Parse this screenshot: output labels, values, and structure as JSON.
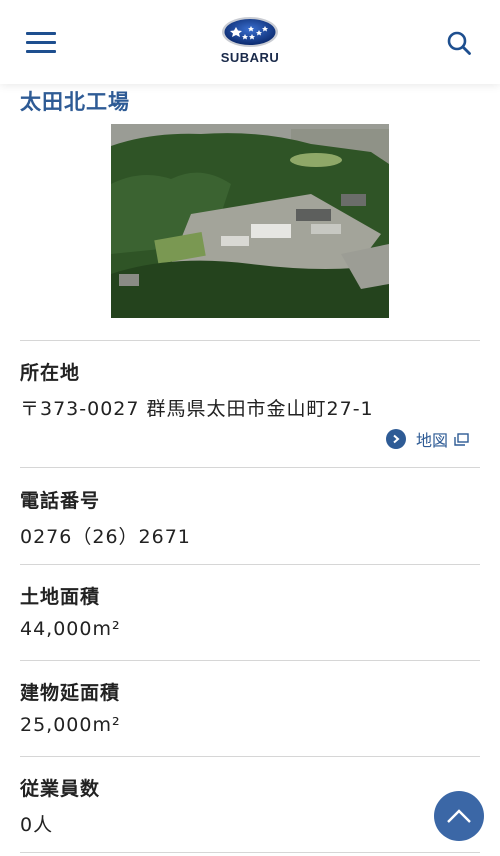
{
  "header": {
    "menu_icon": "hamburger-menu-icon",
    "logo_text": "SUBARU",
    "search_icon": "search-icon"
  },
  "page": {
    "title": "太田北工場"
  },
  "info": {
    "address_label": "所在地",
    "address_value": "〒373-0027 群馬県太田市金山町27-1",
    "map_link_label": "地図",
    "phone_label": "電話番号",
    "phone_value": "0276（26）2671",
    "land_area_label": "土地面積",
    "land_area_value": "44,000m²",
    "floor_area_label": "建物延面積",
    "floor_area_value": "25,000m²",
    "employees_label": "従業員数",
    "employees_value": "0人"
  },
  "colors": {
    "accent": "#2e5b95",
    "scroll_top_bg": "#3b67a6"
  }
}
